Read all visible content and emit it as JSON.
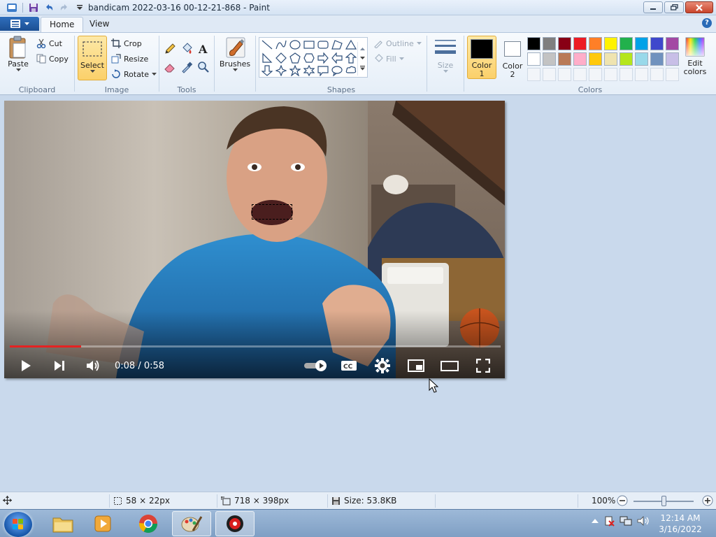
{
  "window": {
    "title": "bandicam 2022-03-16 00-12-21-868 - Paint"
  },
  "quick_access": [
    "save-icon",
    "undo-icon",
    "redo-icon",
    "customize-icon"
  ],
  "tabs": [
    {
      "label": "Home",
      "active": true
    },
    {
      "label": "View",
      "active": false
    }
  ],
  "ribbon": {
    "clipboard": {
      "label": "Clipboard",
      "paste": "Paste",
      "cut": "Cut",
      "copy": "Copy"
    },
    "image": {
      "label": "Image",
      "select": "Select",
      "crop": "Crop",
      "resize": "Resize",
      "rotate": "Rotate"
    },
    "tools": {
      "label": "Tools"
    },
    "brushes": {
      "label": "Brushes"
    },
    "shapes": {
      "label": "Shapes",
      "outline": "Outline",
      "fill": "Fill"
    },
    "size": {
      "label": "Size"
    },
    "colors": {
      "label": "Colors",
      "color1": "Color",
      "color1_num": "1",
      "color2": "Color",
      "color2_num": "2",
      "edit_colors": "Edit colors",
      "color1_value": "#000000",
      "color2_value": "#ffffff",
      "palette_row1": [
        "#000000",
        "#7f7f7f",
        "#880015",
        "#ed1c24",
        "#ff7f27",
        "#fff200",
        "#22b14c",
        "#00a2e8",
        "#3f48cc",
        "#a349a4"
      ],
      "palette_row2": [
        "#ffffff",
        "#c3c3c3",
        "#b97a57",
        "#ffaec9",
        "#ffc90e",
        "#efe4b0",
        "#b5e61d",
        "#99d9ea",
        "#7092be",
        "#c8bfe7"
      ]
    }
  },
  "video": {
    "timecode": "0:08 / 0:58",
    "progress_fraction": 0.145
  },
  "statusbar": {
    "selection_size": "58 × 22px",
    "image_size": "718 × 398px",
    "file_size": "Size: 53.8KB",
    "zoom": "100%"
  },
  "taskbar": {
    "items": [
      "explorer-icon",
      "media-player-icon",
      "chrome-icon",
      "paint-icon",
      "bandicam-icon"
    ],
    "clock_time": "12:14 AM",
    "clock_date": "3/16/2022"
  }
}
